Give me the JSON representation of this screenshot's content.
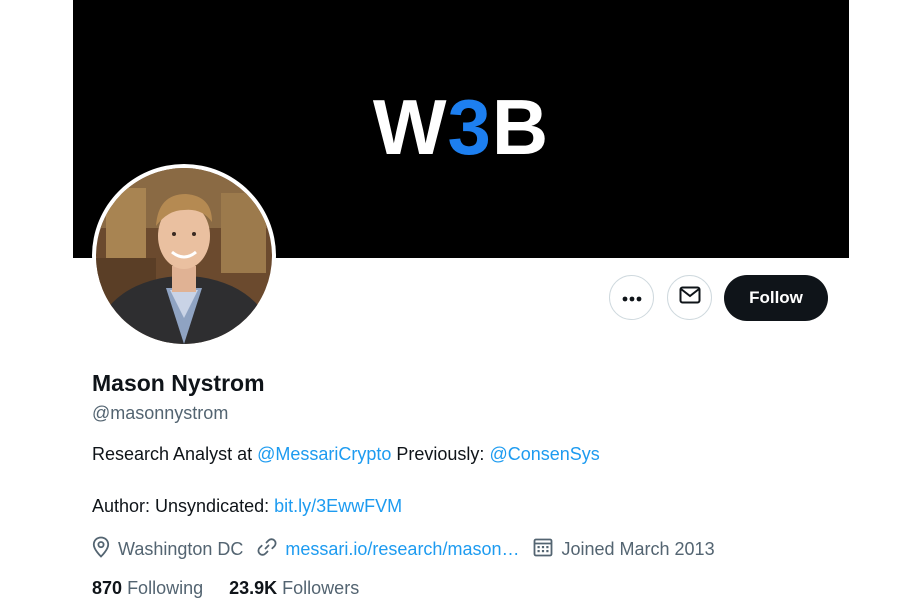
{
  "banner": {
    "logo_part1": "W",
    "logo_part2": "3",
    "logo_part3": "B"
  },
  "profile": {
    "name": "Mason Nystrom",
    "handle": "@masonnystrom",
    "bio": {
      "line1_prefix": "Research Analyst at ",
      "line1_link1": "@MessariCrypto",
      "line1_middle": " Previously: ",
      "line1_link2": "@ConsenSys",
      "line2_prefix": "Author: Unsyndicated: ",
      "line2_link": "bit.ly/3EwwFVM"
    },
    "location": "Washington DC",
    "website": "messari.io/research/mason…",
    "joined": "Joined March 2013",
    "following_count": "870",
    "following_label": "Following",
    "followers_count": "23.9K",
    "followers_label": "Followers"
  },
  "actions": {
    "more_icon": "more-horizontal-icon",
    "message_icon": "envelope-icon",
    "follow_label": "Follow"
  },
  "colors": {
    "link": "#1d9bf0",
    "logo_accent": "#1d7ff0",
    "primary_text": "#0f1419",
    "secondary_text": "#536471",
    "follow_bg": "#0f1419"
  }
}
